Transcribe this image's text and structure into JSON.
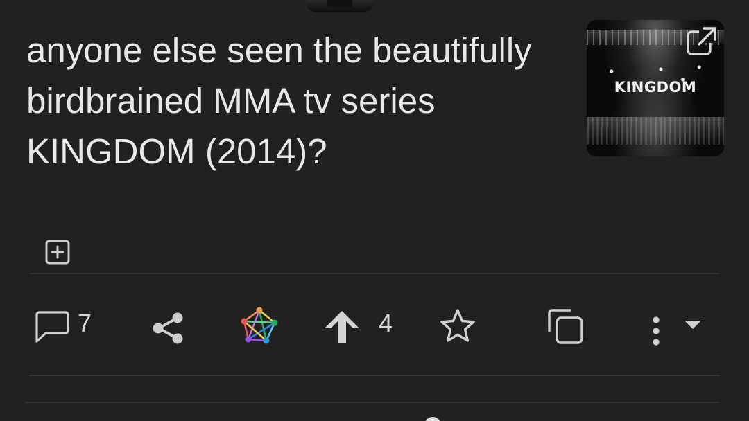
{
  "post": {
    "title": "anyone else seen the beautifully birdbrained MMA tv series KINGDOM (2014)?",
    "thumbnail": {
      "label": "KINGDOM",
      "icon": "external-link-icon"
    },
    "expand_icon": "plus-square-icon"
  },
  "actions": {
    "comments": {
      "icon": "comment-icon",
      "count": "7"
    },
    "share": {
      "icon": "share-icon"
    },
    "fediverse": {
      "icon": "fediverse-icon"
    },
    "upvote": {
      "icon": "arrow-up-icon",
      "count": "4"
    },
    "save": {
      "icon": "star-icon"
    },
    "copy": {
      "icon": "copy-icon"
    },
    "more": {
      "icon": "more-vertical-icon"
    },
    "expand_menu": {
      "icon": "caret-down-icon"
    }
  },
  "colors": {
    "background": "#212121",
    "text": "#e8e8e8",
    "icon": "#d0d0d0",
    "divider": "#343434"
  }
}
